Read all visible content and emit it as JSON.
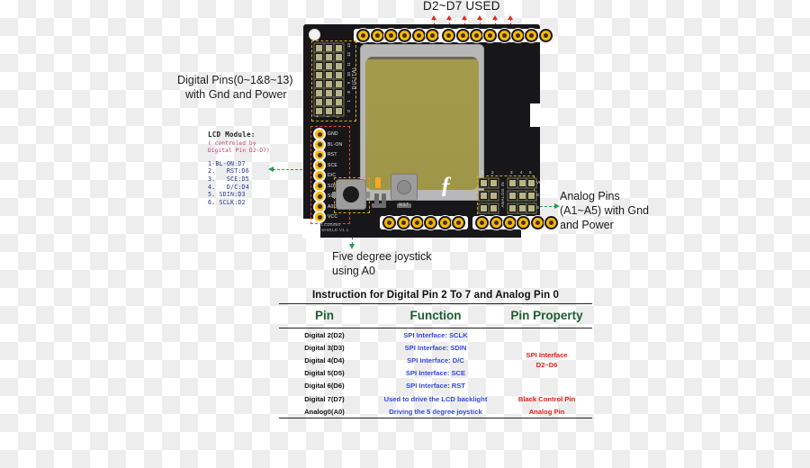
{
  "annotations": {
    "top_label": "D2~D7 USED",
    "digital_pins": "Digital Pins(0~1&8~13)\nwith Gnd and Power",
    "digital_pins_l1": "Digital Pins(0~1&8~13)",
    "digital_pins_l2": "with Gnd and Power",
    "analog_pins_l1": "Analog Pins",
    "analog_pins_l2": "(A1~A5) with Gnd",
    "analog_pins_l3": "and Power",
    "joystick_l1": "Five degree joystick",
    "joystick_l2": "using A0"
  },
  "lcd_note": {
    "title": "LCD Module:",
    "sub_l1": "( controled by",
    "sub_l2": "Digital Pin D2~D7)",
    "pins": [
      "1-BL-ON:D7",
      "2.   RST:D6",
      "3.   SCE:D5",
      "4.   D/C:D4",
      "5. SDIN:D3",
      "6. SCLK:D2"
    ]
  },
  "board": {
    "silk_line1": "LCD4884",
    "silk_line2": "SHIELD V1.1",
    "reset_label": "RST",
    "digital_text": "DIGITAL",
    "analog_text": "ANALOG IN",
    "logo": "ƒ",
    "digital_numbers": [
      "13",
      "12",
      "11",
      "10",
      "9",
      "8",
      "1",
      "0"
    ],
    "digital_symbols": [
      "+",
      "–",
      "⌂"
    ],
    "lcd_pin_labels": [
      "GND",
      "BL-ON",
      "RST",
      "SCE",
      "D/C",
      "SDIN",
      "SCLK",
      "A0D",
      "VCC"
    ],
    "analog_columns": [
      "1",
      "2",
      "3",
      "4",
      "5"
    ],
    "analog_rows": [
      "VDC",
      "GND",
      "S"
    ]
  },
  "table": {
    "title": "Instruction for Digital Pin 2 To 7 and Analog Pin 0",
    "headers": [
      "Pin",
      "Function",
      "Pin Property"
    ],
    "rows": [
      {
        "pin": "Digital 2(D2)",
        "function": "SPI Interface: SCLK"
      },
      {
        "pin": "Digital 3(D3)",
        "function": "SPI Interface: SDIN"
      },
      {
        "pin": "Digital 4(D4)",
        "function": "SPI Interface: D/C"
      },
      {
        "pin": "Digital 5(D5)",
        "function": "SPI Interface: SCE"
      },
      {
        "pin": "Digital 6(D6)",
        "function": "SPI Interface: RST"
      },
      {
        "pin": "Digital 7(D7)",
        "function": "Used to drive the LCD backlight",
        "property": "Black Control Pin"
      },
      {
        "pin": "Analog0(A0)",
        "function": "Driving the 5 degree joystick",
        "property": "Analog Pin"
      }
    ],
    "spi_property_l1": "SPI Interface",
    "spi_property_l2": "D2~D6"
  },
  "colors": {
    "board": "#17171a",
    "pin_gold": "#fbb800",
    "lcd_screen": "#9f9649",
    "header_green": "#1f5c32",
    "function_blue": "#3448d8",
    "property_red": "#e0201a",
    "arrow_green": "#1f9d46",
    "arrow_red": "#e02b20"
  }
}
